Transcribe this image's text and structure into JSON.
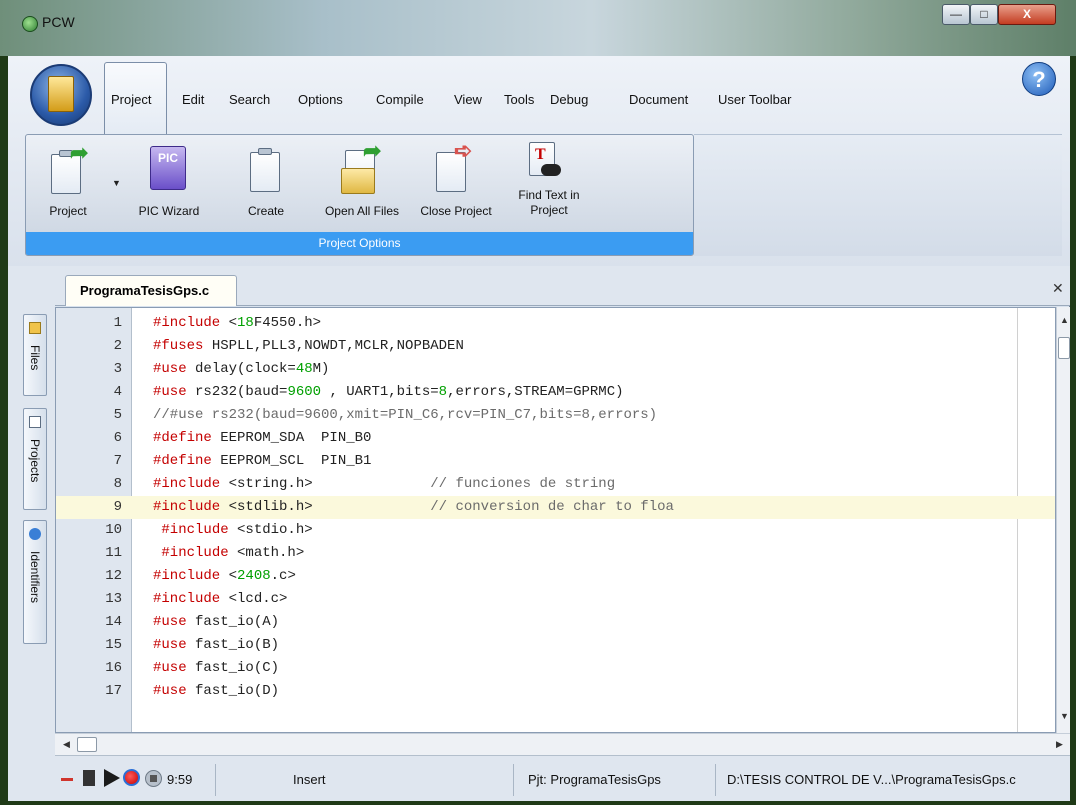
{
  "window": {
    "title": "PCW"
  },
  "menu": {
    "tabs": [
      {
        "label": "Project",
        "active": true
      },
      {
        "label": "Edit"
      },
      {
        "label": "Search"
      },
      {
        "label": "Options"
      },
      {
        "label": "Compile"
      },
      {
        "label": "View"
      },
      {
        "label": "Tools"
      },
      {
        "label": "Debug"
      },
      {
        "label": "Document"
      },
      {
        "label": "User Toolbar"
      }
    ]
  },
  "ribbon": {
    "group_caption": "Project Options",
    "buttons": {
      "project": "Project",
      "pic_wizard": "PIC Wizard",
      "create": "Create",
      "open_all": "Open All Files",
      "close_project": "Close Project",
      "find_text_line1": "Find Text in",
      "find_text_line2": "Project"
    }
  },
  "side_tabs": [
    "Files",
    "Projects",
    "Identifiers"
  ],
  "editor": {
    "file_tab": "ProgramaTesisGps.c",
    "highlighted_line": 9,
    "lines": [
      "1",
      "2",
      "3",
      "4",
      "5",
      "6",
      "7",
      "8",
      "9",
      "10",
      "11",
      "12",
      "13",
      "14",
      "15",
      "16",
      "17"
    ]
  },
  "status": {
    "position": "9:59",
    "mode": "Insert",
    "project": "Pjt: ProgramaTesisGps",
    "path": "D:\\TESIS CONTROL DE V...\\ProgramaTesisGps.c"
  },
  "colors": {
    "keyword": "#c40000",
    "number": "#00a000",
    "comment": "#6b6b6b",
    "group_caption": "#3b9cf2"
  }
}
